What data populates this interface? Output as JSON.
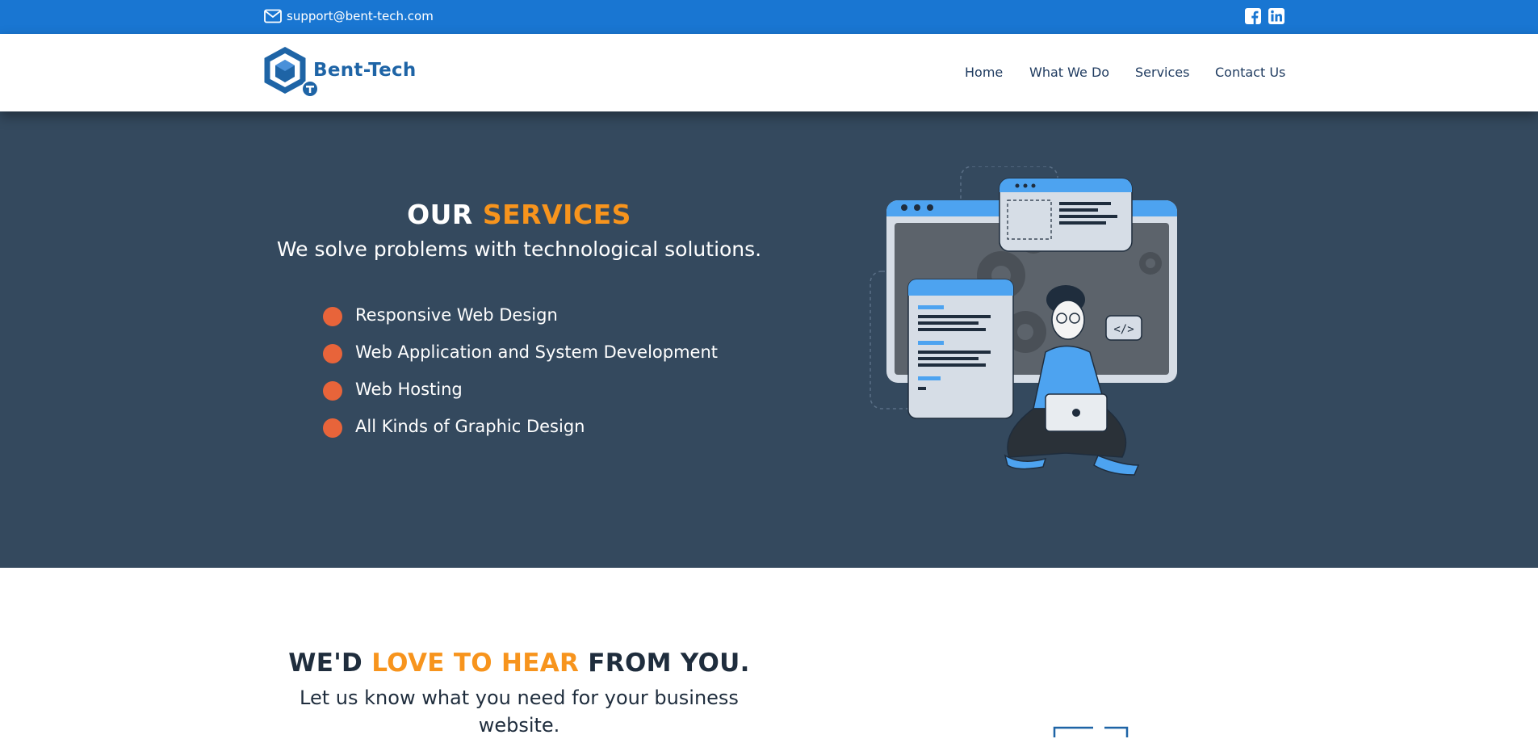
{
  "topbar": {
    "email": "support@bent-tech.com",
    "icons": [
      "mail-icon",
      "facebook-icon",
      "linkedin-icon"
    ]
  },
  "brand": {
    "name": "Bent-Tech"
  },
  "nav": {
    "items": [
      {
        "label": "Home"
      },
      {
        "label": "What We Do"
      },
      {
        "label": "Services"
      },
      {
        "label": "Contact Us"
      }
    ]
  },
  "hero": {
    "title_part1": "OUR ",
    "title_accent": "SERVICES",
    "subtitle": "We solve problems with technological solutions.",
    "services": [
      {
        "label": "Responsive Web Design"
      },
      {
        "label": "Web Application and System Development"
      },
      {
        "label": "Web Hosting"
      },
      {
        "label": "All Kinds of Graphic Design"
      }
    ]
  },
  "contact": {
    "title_part1": "WE'D ",
    "title_accent": "LOVE TO HEAR",
    "title_part2": " FROM YOU.",
    "subtitle": "Let us know what you need for your business website."
  },
  "colors": {
    "topbar": "#1976d2",
    "hero_bg": "#34495e",
    "accent_orange": "#f7941d",
    "bullet": "#e8643a",
    "brand_blue": "#1e64a6"
  }
}
